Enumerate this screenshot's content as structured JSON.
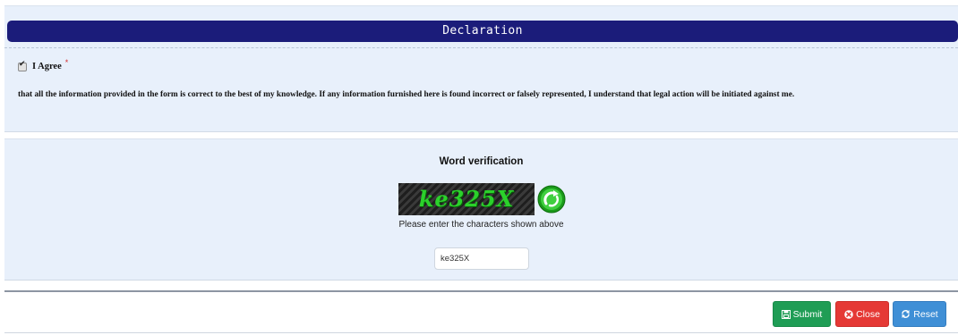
{
  "declaration": {
    "header": "Declaration",
    "agree_label": "I Agree",
    "required_mark": "*",
    "agree_checked": true,
    "text": "that all the information provided in the form is correct to the best of my knowledge. If any information furnished here is found incorrect or falsely represented, I understand that legal action will be initiated against me."
  },
  "verification": {
    "title": "Word verification",
    "captcha_text": "ke325X",
    "refresh_icon": "refresh-icon",
    "hint": "Please enter the characters shown above",
    "input_value": "ke325X"
  },
  "actions": {
    "submit_label": "Submit",
    "close_label": "Close",
    "reset_label": "Reset",
    "submit_icon": "save-icon",
    "close_icon": "close-circle-icon",
    "reset_icon": "refresh-icon",
    "submit_color": "#1f9d55",
    "close_color": "#e53935",
    "reset_color": "#3f8fd6"
  },
  "theme": {
    "header_color": "#1b1c7a",
    "panel_color": "#e8f0fb",
    "captcha_text_color": "#2bd12b"
  }
}
